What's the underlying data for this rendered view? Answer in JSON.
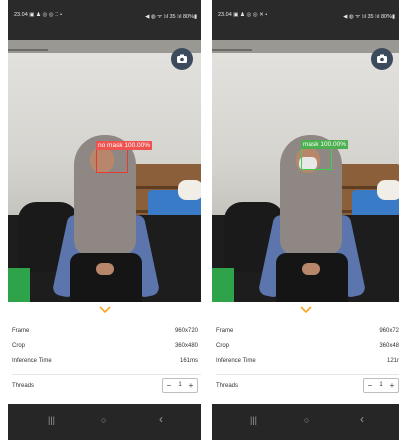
{
  "colors": {
    "status_bar": "#2a2a2a",
    "nav_bar": "#262626",
    "no_mask_box": "#e53935",
    "no_mask_label_bg": "#ef5350",
    "mask_box": "#3ad24a",
    "mask_label_bg": "#4caf50",
    "accent_chevron": "#f5a623"
  },
  "screens": [
    {
      "status": {
        "time_icons": "23.04 ▣ ♟ ◎ ◎ ⁚⁚ •",
        "right_icons": "◀ ◍ ᯤ ⁞ıl 35 ⁞ıl 80%▮"
      },
      "detection": {
        "label": "no mask 100.00%",
        "class": "no mask",
        "confidence": "100.00%"
      },
      "camera_switch_icon": "camera-switch-icon",
      "stats": [
        {
          "key": "Frame",
          "value": "960x720"
        },
        {
          "key": "Crop",
          "value": "360x480"
        },
        {
          "key": "Inference Time",
          "value": "161ms"
        }
      ],
      "threads": {
        "label": "Threads",
        "value": "1",
        "minus": "−",
        "plus": "+"
      },
      "nav": {
        "recents": "|||",
        "home": "○",
        "back": "‹"
      }
    },
    {
      "status": {
        "time_icons": "23.04 ▣ ♟ ◎ ◎ ✕ •",
        "right_icons": "◀ ◍ ᯤ ⁞ıl 35 ⁞ıl 80%▮"
      },
      "detection": {
        "label": "mask 100.00%",
        "class": "mask",
        "confidence": "100.00%"
      },
      "camera_switch_icon": "camera-switch-icon",
      "stats": [
        {
          "key": "Frame",
          "value": "960x72"
        },
        {
          "key": "Crop",
          "value": "360x48"
        },
        {
          "key": "Inference Time",
          "value": "121r"
        }
      ],
      "threads": {
        "label": "Threads",
        "value": "1",
        "minus": "−",
        "plus": "+"
      },
      "nav": {
        "recents": "|||",
        "home": "○",
        "back": "‹"
      }
    }
  ]
}
